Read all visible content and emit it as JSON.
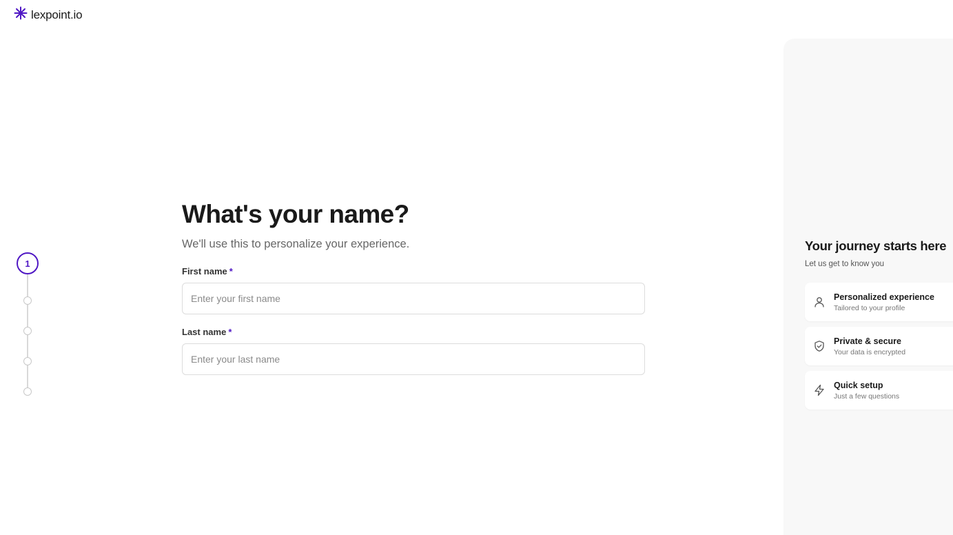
{
  "brand": {
    "name": "lexpoint.io",
    "accent_color": "#4f17c4"
  },
  "stepper": {
    "current_step": "1",
    "total_steps": 5
  },
  "form": {
    "title": "What's your name?",
    "subtitle": "We'll use this to personalize your experience.",
    "first_name": {
      "label": "First name",
      "required_mark": "*",
      "placeholder": "Enter your first name",
      "value": ""
    },
    "last_name": {
      "label": "Last name",
      "required_mark": "*",
      "placeholder": "Enter your last name",
      "value": ""
    }
  },
  "side_panel": {
    "title": "Your journey starts here",
    "subtitle": "Let us get to know you",
    "features": [
      {
        "icon": "user-icon",
        "title": "Personalized experience",
        "description": "Tailored to your profile"
      },
      {
        "icon": "shield-check-icon",
        "title": "Private & secure",
        "description": "Your data is encrypted"
      },
      {
        "icon": "lightning-icon",
        "title": "Quick setup",
        "description": "Just a few questions"
      }
    ]
  }
}
